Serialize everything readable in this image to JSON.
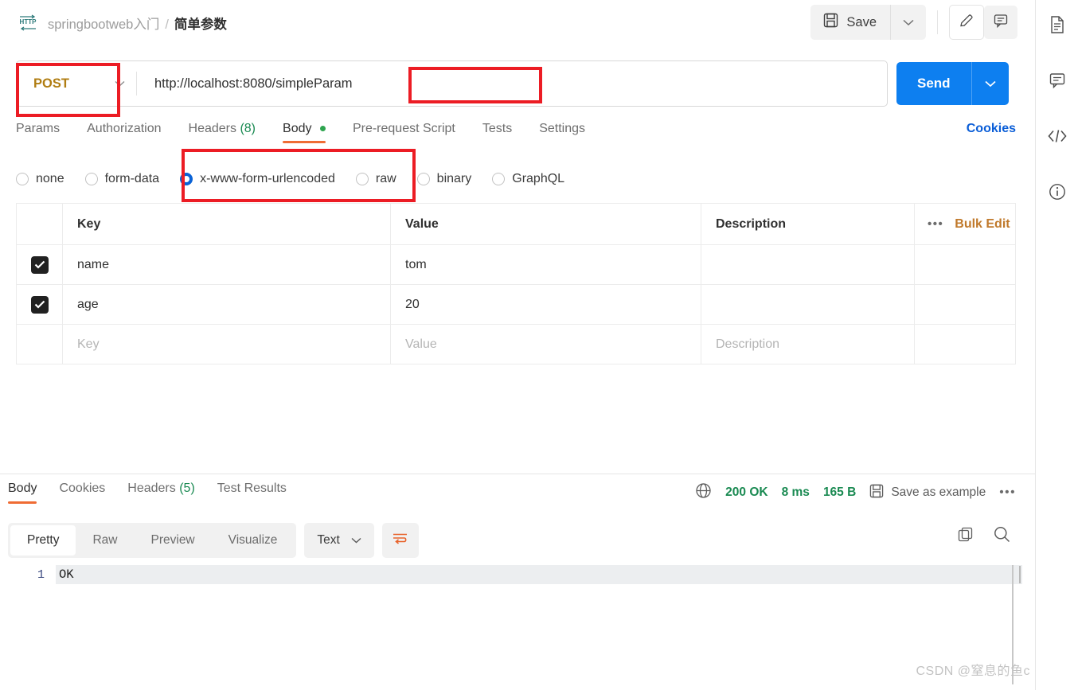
{
  "header": {
    "protocol_badge": "HTTP",
    "breadcrumb": {
      "collection": "springbootweb入门",
      "separator": "/",
      "current": "简单参数"
    },
    "save_label": "Save",
    "save_caret": "⌄",
    "icons": {
      "save": "floppy-disk-icon",
      "edit": "pencil-icon",
      "comment": "comment-icon"
    }
  },
  "request": {
    "method": "POST",
    "method_caret": "⌄",
    "url": "http://localhost:8080/simpleParam",
    "send_label": "Send",
    "send_caret": "⌄",
    "send_color": "#0d7ff0",
    "tabs": [
      {
        "label": "Params",
        "count": "",
        "active": false,
        "dot": false
      },
      {
        "label": "Authorization",
        "count": "",
        "active": false,
        "dot": false
      },
      {
        "label": "Headers",
        "count": "(8)",
        "active": false,
        "dot": false
      },
      {
        "label": "Body",
        "count": "",
        "active": true,
        "dot": true
      },
      {
        "label": "Pre-request Script",
        "count": "",
        "active": false,
        "dot": false
      },
      {
        "label": "Tests",
        "count": "",
        "active": false,
        "dot": false
      },
      {
        "label": "Settings",
        "count": "",
        "active": false,
        "dot": false
      }
    ],
    "cookies_link": "Cookies",
    "body_modes": [
      {
        "label": "none",
        "checked": false
      },
      {
        "label": "form-data",
        "checked": false
      },
      {
        "label": "x-www-form-urlencoded",
        "checked": true
      },
      {
        "label": "raw",
        "checked": false
      },
      {
        "label": "binary",
        "checked": false
      },
      {
        "label": "GraphQL",
        "checked": false
      }
    ],
    "table": {
      "columns": [
        "Key",
        "Value",
        "Description"
      ],
      "more_dots": "•••",
      "bulk_edit": "Bulk Edit",
      "rows": [
        {
          "checked": true,
          "key": "name",
          "value": "tom",
          "description": ""
        },
        {
          "checked": true,
          "key": "age",
          "value": "20",
          "description": ""
        }
      ],
      "placeholder_row": {
        "key": "Key",
        "value": "Value",
        "description": "Description"
      }
    }
  },
  "response": {
    "tabs": [
      {
        "label": "Body",
        "count": "",
        "active": true
      },
      {
        "label": "Cookies",
        "count": "",
        "active": false
      },
      {
        "label": "Headers",
        "count": "(5)",
        "active": false
      },
      {
        "label": "Test Results",
        "count": "",
        "active": false
      }
    ],
    "status": {
      "globe_icon": "globe-icon",
      "code": "200 OK",
      "time": "8 ms",
      "size": "165 B",
      "save_example": "Save as example",
      "more": "•••",
      "status_color": "#1a8a52"
    },
    "viewer_tabs": [
      {
        "label": "Pretty",
        "active": true
      },
      {
        "label": "Raw",
        "active": false
      },
      {
        "label": "Preview",
        "active": false
      },
      {
        "label": "Visualize",
        "active": false
      }
    ],
    "language": "Text",
    "language_caret": "⌄",
    "wrap_icon": "word-wrap-icon",
    "copy_icon": "copy-icon",
    "search_icon": "search-icon",
    "body_lines": [
      {
        "number": "1",
        "text": "OK"
      }
    ]
  },
  "rail": {
    "items": [
      {
        "icon": "document-icon",
        "name": "documentation"
      },
      {
        "icon": "comment-icon",
        "name": "comments"
      },
      {
        "icon": "code-icon",
        "name": "code-snippet"
      },
      {
        "icon": "info-icon",
        "name": "info"
      }
    ]
  },
  "annotations": {
    "color": "#ec1c24",
    "boxes": [
      "method-selector",
      "url-suffix-area",
      "x-www-form-urlencoded-option"
    ]
  },
  "watermark": "CSDN @窒息的鱼c"
}
